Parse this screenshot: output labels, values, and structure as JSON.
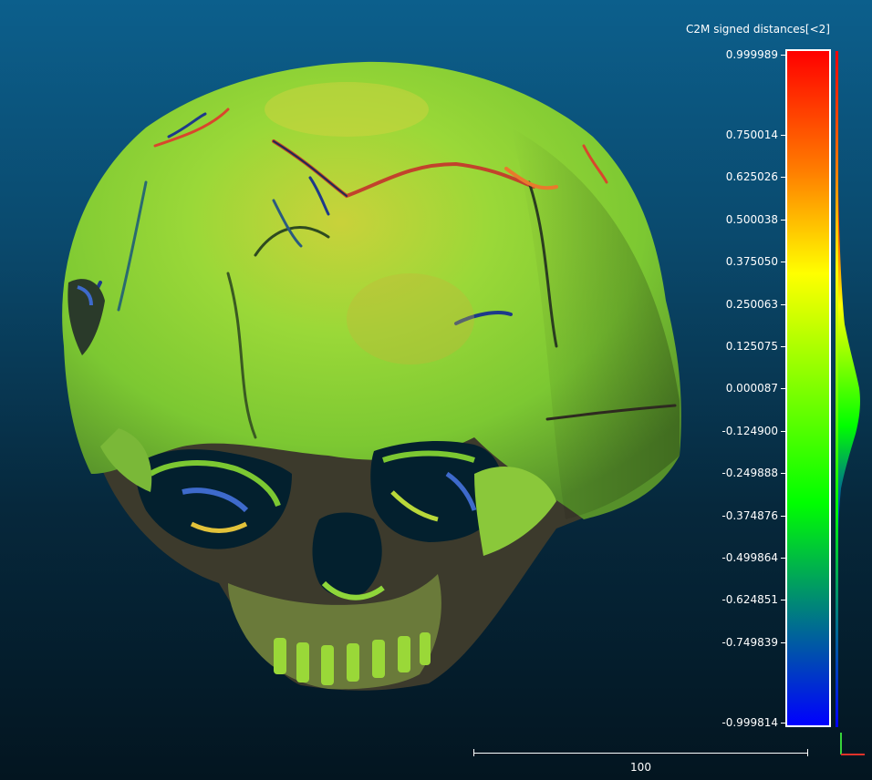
{
  "scale": {
    "title": "C2M signed distances[<2]",
    "ticks": [
      {
        "label": "0.999989",
        "value": 0.999989
      },
      {
        "label": "0.750014",
        "value": 0.750014
      },
      {
        "label": "0.625026",
        "value": 0.625026
      },
      {
        "label": "0.500038",
        "value": 0.500038
      },
      {
        "label": "0.375050",
        "value": 0.37505
      },
      {
        "label": "0.250063",
        "value": 0.250063
      },
      {
        "label": "0.125075",
        "value": 0.125075
      },
      {
        "label": "0.000087",
        "value": 8.7e-05
      },
      {
        "label": "-0.124900",
        "value": -0.1249
      },
      {
        "label": "-0.249888",
        "value": -0.249888
      },
      {
        "label": "-0.374876",
        "value": -0.374876
      },
      {
        "label": "-0.499864",
        "value": -0.499864
      },
      {
        "label": "-0.624851",
        "value": -0.624851
      },
      {
        "label": "-0.749839",
        "value": -0.749839
      },
      {
        "label": "-0.999814",
        "value": -0.999814
      }
    ],
    "min": -0.999814,
    "max": 0.999989,
    "gradient_colors": [
      "#ff0000",
      "#ff7f00",
      "#ffff00",
      "#7fff00",
      "#00ff00",
      "#007f7f",
      "#0000ff"
    ]
  },
  "scalebar": {
    "label": "100"
  },
  "colors": {
    "background_top": "#0c5f8c",
    "background_bottom": "#031520",
    "surface_main": "#8fd63a",
    "surface_shadow": "#3e3a2a"
  }
}
